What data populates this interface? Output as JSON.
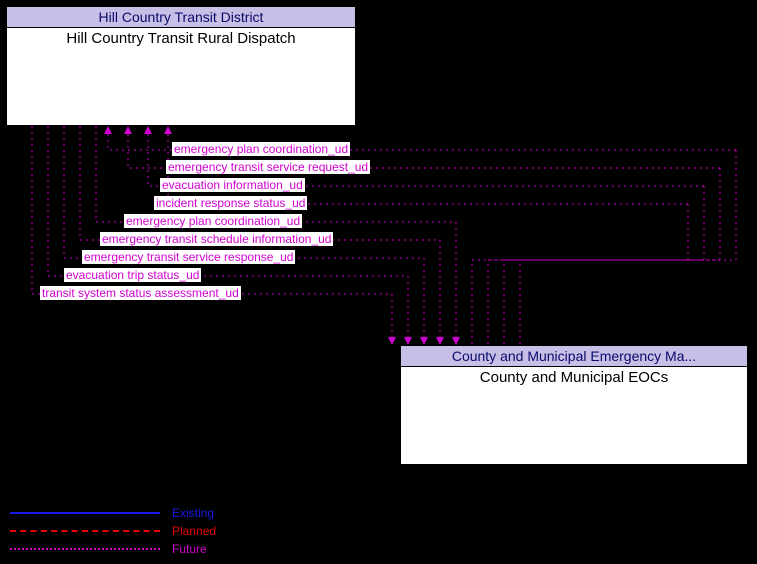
{
  "top_box": {
    "header": "Hill Country Transit District",
    "title": "Hill Country Transit Rural Dispatch"
  },
  "bottom_box": {
    "header": "County and Municipal Emergency Ma...",
    "title": "County and Municipal EOCs"
  },
  "flows": {
    "to_top": [
      "emergency plan coordination_ud",
      "emergency transit service request_ud",
      "evacuation information_ud",
      "incident response status_ud"
    ],
    "to_bottom": [
      "emergency plan coordination_ud",
      "emergency transit schedule information_ud",
      "emergency transit service response_ud",
      "evacuation trip status_ud",
      "transit system status assessment_ud"
    ]
  },
  "legend": {
    "existing": "Existing",
    "planned": "Planned",
    "future": "Future"
  },
  "chart_data": {
    "type": "diagram",
    "nodes": [
      {
        "id": "hctrd",
        "label": "Hill Country Transit Rural Dispatch",
        "owner": "Hill Country Transit District"
      },
      {
        "id": "eoc",
        "label": "County and Municipal EOCs",
        "owner": "County and Municipal Emergency Management"
      }
    ],
    "edges": [
      {
        "from": "eoc",
        "to": "hctrd",
        "label": "emergency plan coordination_ud",
        "status": "Future"
      },
      {
        "from": "eoc",
        "to": "hctrd",
        "label": "emergency transit service request_ud",
        "status": "Future"
      },
      {
        "from": "eoc",
        "to": "hctrd",
        "label": "evacuation information_ud",
        "status": "Future"
      },
      {
        "from": "eoc",
        "to": "hctrd",
        "label": "incident response status_ud",
        "status": "Future"
      },
      {
        "from": "hctrd",
        "to": "eoc",
        "label": "emergency plan coordination_ud",
        "status": "Future"
      },
      {
        "from": "hctrd",
        "to": "eoc",
        "label": "emergency transit schedule information_ud",
        "status": "Future"
      },
      {
        "from": "hctrd",
        "to": "eoc",
        "label": "emergency transit service response_ud",
        "status": "Future"
      },
      {
        "from": "hctrd",
        "to": "eoc",
        "label": "evacuation trip status_ud",
        "status": "Future"
      },
      {
        "from": "hctrd",
        "to": "eoc",
        "label": "transit system status assessment_ud",
        "status": "Future"
      }
    ],
    "legend": [
      "Existing",
      "Planned",
      "Future"
    ]
  }
}
